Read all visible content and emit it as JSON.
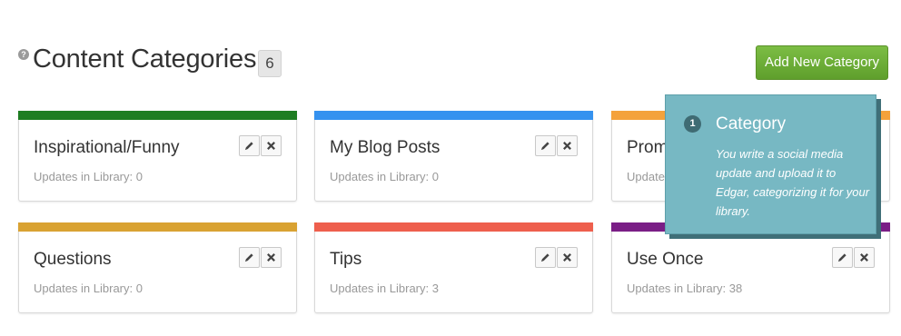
{
  "header": {
    "help_icon": "?",
    "title": "Content Categories",
    "count": "6",
    "add_button_label": "Add New Category"
  },
  "categories": [
    {
      "name": "Inspirational/Funny",
      "updates": "Updates in Library: 0",
      "color": "#1e7d22"
    },
    {
      "name": "My Blog Posts",
      "updates": "Updates in Library: 0",
      "color": "#3592ef"
    },
    {
      "name": "Prom",
      "updates": "Update",
      "color": "#f4a23b"
    },
    {
      "name": "Questions",
      "updates": "Updates in Library: 0",
      "color": "#d9a232"
    },
    {
      "name": "Tips",
      "updates": "Updates in Library: 3",
      "color": "#ee5f4d"
    },
    {
      "name": "Use Once",
      "updates": "Updates in Library: 38",
      "color": "#7a1e86"
    }
  ],
  "icons": {
    "edit": "pencil-icon",
    "delete": "close-icon"
  },
  "tooltip": {
    "step": "1",
    "title": "Category",
    "body": "You write a social media update and upload it to Edgar, categorizing it for your library."
  }
}
